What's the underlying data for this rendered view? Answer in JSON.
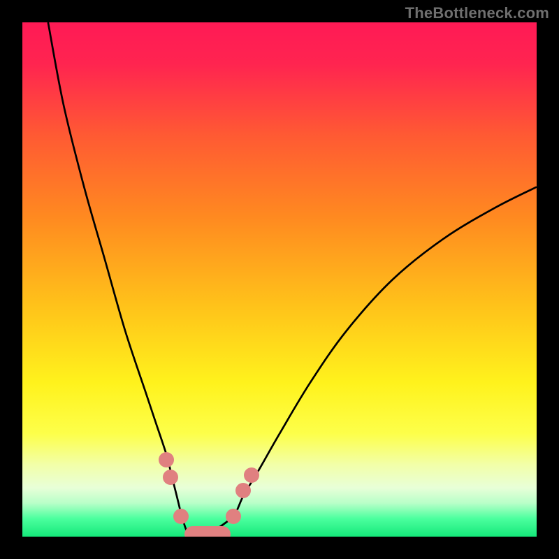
{
  "watermark": "TheBottleneck.com",
  "gradient_stops": [
    {
      "offset": 0.0,
      "color": "#ff1a55"
    },
    {
      "offset": 0.08,
      "color": "#ff2450"
    },
    {
      "offset": 0.22,
      "color": "#ff5a33"
    },
    {
      "offset": 0.38,
      "color": "#ff8a20"
    },
    {
      "offset": 0.55,
      "color": "#ffc21a"
    },
    {
      "offset": 0.7,
      "color": "#fff21c"
    },
    {
      "offset": 0.8,
      "color": "#fdff4a"
    },
    {
      "offset": 0.86,
      "color": "#f2ffa8"
    },
    {
      "offset": 0.905,
      "color": "#e8ffd8"
    },
    {
      "offset": 0.935,
      "color": "#b8ffc8"
    },
    {
      "offset": 0.965,
      "color": "#4bff9e"
    },
    {
      "offset": 1.0,
      "color": "#15e87a"
    }
  ],
  "chart_data": {
    "type": "line",
    "title": "",
    "xlabel": "",
    "ylabel": "",
    "xlim": [
      0,
      100
    ],
    "ylim": [
      0,
      100
    ],
    "grid": false,
    "series": [
      {
        "name": "curve",
        "x": [
          5,
          8,
          12,
          16,
          20,
          24,
          26,
          28,
          29,
          30,
          31,
          32,
          33,
          34,
          35,
          37,
          41,
          43,
          46,
          50,
          56,
          63,
          72,
          82,
          92,
          100
        ],
        "y": [
          100,
          84,
          68,
          54,
          40,
          28,
          22,
          16,
          12,
          8,
          4,
          1,
          0,
          0,
          0,
          1,
          4,
          8,
          13,
          20,
          30,
          40,
          50,
          58,
          64,
          68
        ]
      }
    ],
    "annotations": [
      {
        "name": "left-dot-1",
        "shape": "dot",
        "x": 28.0,
        "y": 15.0
      },
      {
        "name": "left-dot-2",
        "shape": "dot",
        "x": 28.8,
        "y": 11.5
      },
      {
        "name": "left-dot-3",
        "shape": "dot",
        "x": 30.8,
        "y": 4.0
      },
      {
        "name": "right-dot-1",
        "shape": "dot",
        "x": 41.0,
        "y": 4.0
      },
      {
        "name": "right-dot-2",
        "shape": "dot",
        "x": 43.0,
        "y": 9.0
      },
      {
        "name": "right-dot-3",
        "shape": "dot",
        "x": 44.5,
        "y": 12.0
      },
      {
        "name": "bottom-bar",
        "shape": "bar",
        "x0": 31.5,
        "x1": 40.5,
        "y": 0.5,
        "h": 3.2
      }
    ],
    "marker_color": "#e08080",
    "curve_color": "#000000",
    "curve_width": 2.7
  }
}
